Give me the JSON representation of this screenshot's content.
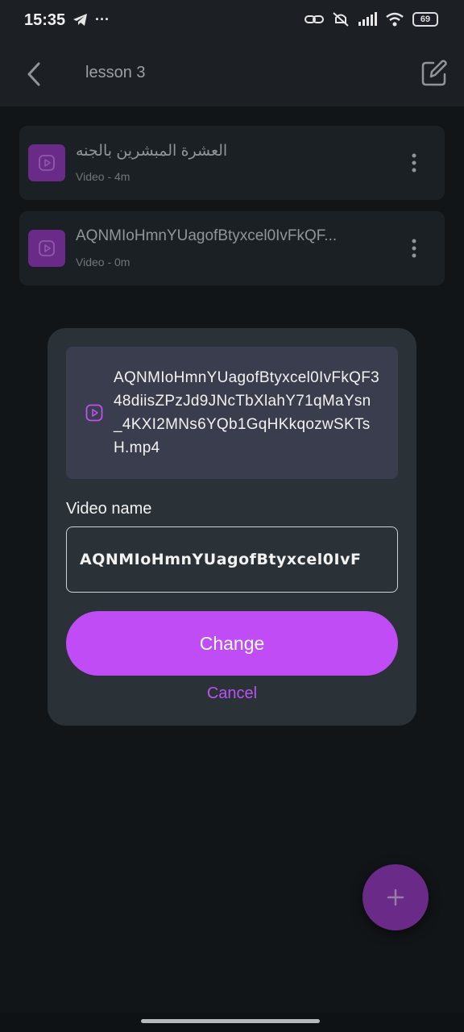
{
  "status_bar": {
    "time": "15:35",
    "more": "···",
    "battery": "69",
    "left_icons": [
      "telegram-icon"
    ],
    "right_icons": [
      "link-icon",
      "mute-icon",
      "signal-icon",
      "wifi-icon",
      "battery-icon"
    ]
  },
  "app_bar": {
    "title": "lesson 3"
  },
  "lessons": [
    {
      "title": "العشرة المبشرين بالجنه",
      "subtitle": "Video - 4m"
    },
    {
      "title": "AQNMIoHmnYUagofBtyxcel0IvFkQF...",
      "subtitle": "Video - 0m"
    }
  ],
  "dialog": {
    "file_name": "AQNMIoHmnYUagofBtyxcel0IvFkQF348diisZPzJd9JNcTbXlahY71qMaYsn_4KXI2MNs6YQb1GqHKkqozwSKTsH.mp4",
    "field_label": "Video name",
    "field_value": "AQNMIoHmnYUagofBtyxcel0IvF",
    "change_label": "Change",
    "cancel_label": "Cancel"
  },
  "colors": {
    "accent": "#bf4cf5",
    "thumb": "#6a2b88",
    "dialog_bg": "#2a3237",
    "file_box_bg": "#3a3d4e"
  }
}
